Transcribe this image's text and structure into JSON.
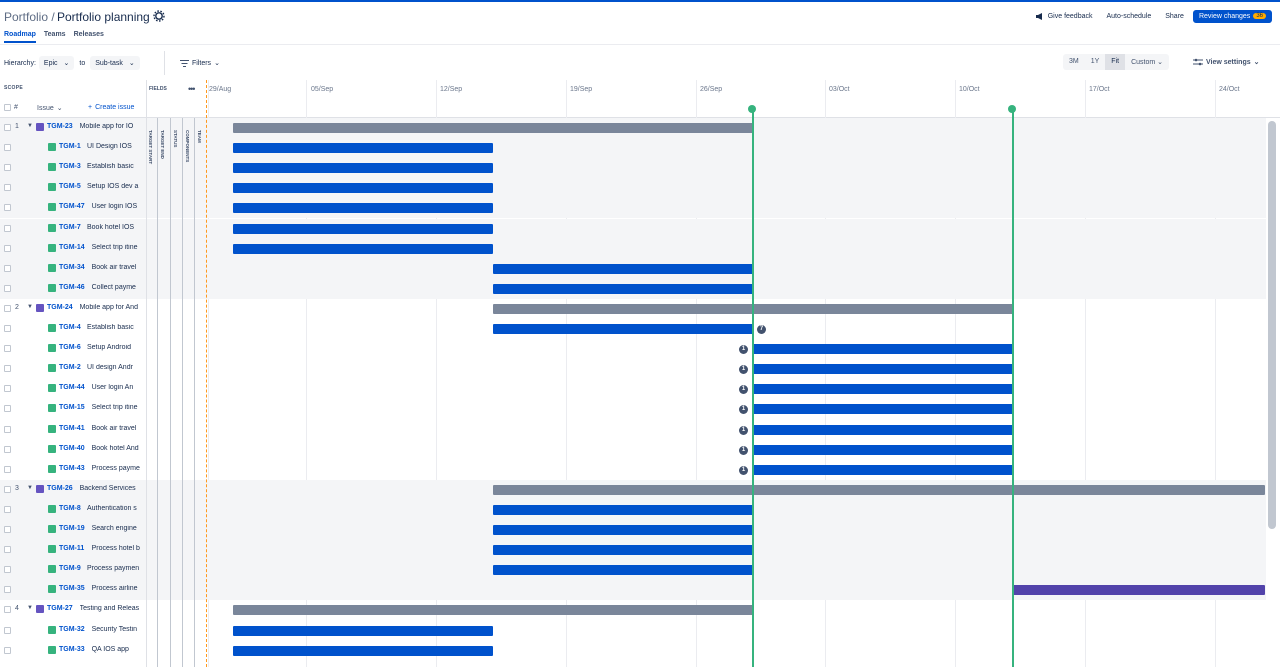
{
  "header": {
    "breadcrumb": "Portfolio /",
    "title": "Portfolio planning",
    "give_feedback": "Give feedback",
    "auto_schedule": "Auto-schedule",
    "share": "Share",
    "review_changes": "Review changes",
    "review_count": "36"
  },
  "tabs": [
    "Roadmap",
    "Teams",
    "Releases"
  ],
  "toolbar": {
    "hierarchy_label": "Hierarchy:",
    "from": "Epic",
    "to_label": "to",
    "to": "Sub-task",
    "filters": "Filters",
    "zoom": [
      "3M",
      "1Y",
      "Fit",
      "Custom"
    ],
    "view_settings": "View settings"
  },
  "timeline": {
    "scope_label": "SCOPE",
    "fields_label": "FIELDS",
    "hash": "#",
    "issue_col": "Issue",
    "create_issue": "Create issue",
    "field_columns": [
      "TARGET START",
      "TARGET END",
      "STATUS",
      "COMPONENTS",
      "TEAM"
    ],
    "dates": [
      "29/Aug",
      "05/Sep",
      "12/Sep",
      "19/Sep",
      "26/Sep",
      "03/Oct",
      "10/Oct",
      "17/Oct",
      "24/Oct"
    ]
  },
  "colors": {
    "grey": "#7a869a",
    "blue": "#0052cc",
    "purple": "#5243aa",
    "release": "#36b37e",
    "today": "#ff991f"
  },
  "rows": [
    {
      "num": "1",
      "type": "epic",
      "key": "TGM-23",
      "summary": "Mobile app for IO",
      "bar": "grey",
      "start": 0,
      "end": 4,
      "shade": true,
      "dep_l": "",
      "dep_r": ""
    },
    {
      "type": "story",
      "key": "TGM-1",
      "summary": "UI Design IOS",
      "bar": "blue",
      "start": 0,
      "end": 2,
      "shade": true,
      "dep_l": "",
      "dep_r": ""
    },
    {
      "type": "story",
      "key": "TGM-3",
      "summary": "Establish basic",
      "bar": "blue",
      "start": 0,
      "end": 2,
      "shade": true,
      "dep_l": "",
      "dep_r": ""
    },
    {
      "type": "story",
      "key": "TGM-5",
      "summary": "Setup IOS dev a",
      "bar": "blue",
      "start": 0,
      "end": 2,
      "shade": true,
      "dep_l": "",
      "dep_r": ""
    },
    {
      "type": "story",
      "key": "TGM-47",
      "summary": "User login IOS",
      "bar": "blue",
      "start": 0,
      "end": 2,
      "shade": true,
      "dep_l": "",
      "dep_r": ""
    },
    {
      "type": "story",
      "key": "TGM-7",
      "summary": "Book hotel IOS",
      "bar": "blue",
      "start": 0,
      "end": 2,
      "shade": true,
      "dep_l": "",
      "dep_r": ""
    },
    {
      "type": "story",
      "key": "TGM-14",
      "summary": "Select trip itine",
      "bar": "blue",
      "start": 0,
      "end": 2,
      "shade": true,
      "dep_l": "",
      "dep_r": ""
    },
    {
      "type": "story",
      "key": "TGM-34",
      "summary": "Book air travel",
      "bar": "blue",
      "start": 2,
      "end": 4,
      "shade": true,
      "dep_l": "",
      "dep_r": ""
    },
    {
      "type": "story",
      "key": "TGM-46",
      "summary": "Collect payme",
      "bar": "blue",
      "start": 2,
      "end": 4,
      "shade": true,
      "dep_l": "",
      "dep_r": ""
    },
    {
      "num": "2",
      "type": "epic",
      "key": "TGM-24",
      "summary": "Mobile app for And",
      "bar": "grey",
      "start": 2,
      "end": 6,
      "shade": false,
      "dep_l": "",
      "dep_r": ""
    },
    {
      "type": "story",
      "key": "TGM-4",
      "summary": "Establish basic",
      "bar": "blue",
      "start": 2,
      "end": 4,
      "shade": false,
      "dep_l": "",
      "dep_r": "7"
    },
    {
      "type": "story",
      "key": "TGM-6",
      "summary": "Setup Android",
      "bar": "blue",
      "start": 4,
      "end": 6,
      "shade": false,
      "dep_l": "1",
      "dep_r": ""
    },
    {
      "type": "story",
      "key": "TGM-2",
      "summary": "UI design Andr",
      "bar": "blue",
      "start": 4,
      "end": 6,
      "shade": false,
      "dep_l": "1",
      "dep_r": ""
    },
    {
      "type": "story",
      "key": "TGM-44",
      "summary": "User login An",
      "bar": "blue",
      "start": 4,
      "end": 6,
      "shade": false,
      "dep_l": "1",
      "dep_r": ""
    },
    {
      "type": "story",
      "key": "TGM-15",
      "summary": "Select trip itine",
      "bar": "blue",
      "start": 4,
      "end": 6,
      "shade": false,
      "dep_l": "1",
      "dep_r": ""
    },
    {
      "type": "story",
      "key": "TGM-41",
      "summary": "Book air travel",
      "bar": "blue",
      "start": 4,
      "end": 6,
      "shade": false,
      "dep_l": "1",
      "dep_r": ""
    },
    {
      "type": "story",
      "key": "TGM-40",
      "summary": "Book hotel And",
      "bar": "blue",
      "start": 4,
      "end": 6,
      "shade": false,
      "dep_l": "1",
      "dep_r": ""
    },
    {
      "type": "story",
      "key": "TGM-43",
      "summary": "Process payme",
      "bar": "blue",
      "start": 4,
      "end": 6,
      "shade": false,
      "dep_l": "1",
      "dep_r": ""
    },
    {
      "num": "3",
      "type": "epic",
      "key": "TGM-26",
      "summary": "Backend Services",
      "bar": "grey",
      "start": 2,
      "end": 8.1,
      "shade": true,
      "dep_l": "",
      "dep_r": ""
    },
    {
      "type": "story",
      "key": "TGM-8",
      "summary": "Authentication s",
      "bar": "blue",
      "start": 2,
      "end": 4,
      "shade": true,
      "dep_l": "",
      "dep_r": ""
    },
    {
      "type": "story",
      "key": "TGM-19",
      "summary": "Search engine",
      "bar": "blue",
      "start": 2,
      "end": 4,
      "shade": true,
      "dep_l": "",
      "dep_r": ""
    },
    {
      "type": "story",
      "key": "TGM-11",
      "summary": "Process hotel b",
      "bar": "blue",
      "start": 2,
      "end": 4,
      "shade": true,
      "dep_l": "",
      "dep_r": ""
    },
    {
      "type": "story",
      "key": "TGM-9",
      "summary": "Process paymen",
      "bar": "blue",
      "start": 2,
      "end": 4,
      "shade": true,
      "dep_l": "",
      "dep_r": ""
    },
    {
      "type": "story",
      "key": "TGM-35",
      "summary": "Process airline",
      "bar": "purple",
      "start": 6,
      "end": 8.1,
      "shade": true,
      "dep_l": "",
      "dep_r": ""
    },
    {
      "num": "4",
      "type": "epic",
      "key": "TGM-27",
      "summary": "Testing and Releas",
      "bar": "grey",
      "start": 0,
      "end": 4,
      "shade": false,
      "dep_l": "",
      "dep_r": ""
    },
    {
      "type": "story",
      "key": "TGM-32",
      "summary": "Security Testin",
      "bar": "blue",
      "start": 0,
      "end": 2,
      "shade": false,
      "dep_l": "",
      "dep_r": ""
    },
    {
      "type": "story",
      "key": "TGM-33",
      "summary": "QA IOS app",
      "bar": "blue",
      "start": 0,
      "end": 2,
      "shade": false,
      "dep_l": "",
      "dep_r": ""
    }
  ]
}
